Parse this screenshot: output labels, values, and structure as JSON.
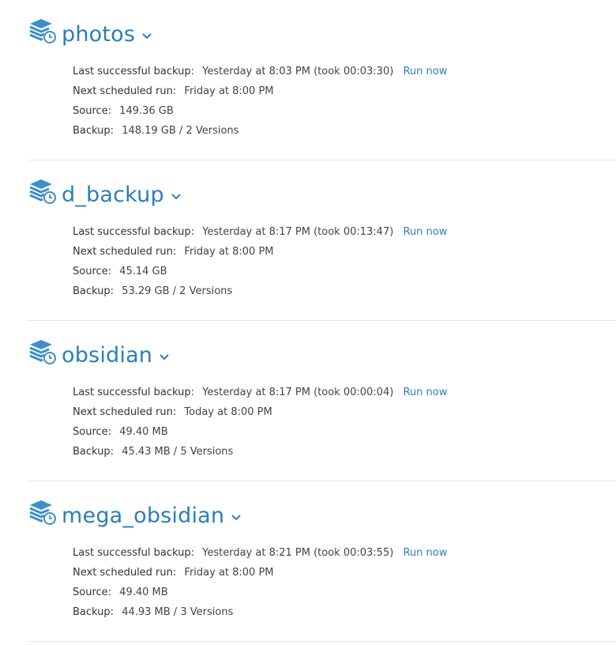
{
  "labels": {
    "last_backup": "Last successful backup:",
    "next_run": "Next scheduled run:",
    "source": "Source:",
    "backup": "Backup:",
    "run_now": "Run now"
  },
  "colors": {
    "accent": "#2a7fb7",
    "icon": "#3d8fcc",
    "divider": "#e6e6e6"
  },
  "backups": [
    {
      "name": "photos",
      "last_backup": "Yesterday at 8:03 PM (took 00:03:30)",
      "next_run": "Friday at 8:00 PM",
      "source": "149.36 GB",
      "backup": "148.19 GB / 2 Versions"
    },
    {
      "name": "d_backup",
      "last_backup": "Yesterday at 8:17 PM (took 00:13:47)",
      "next_run": "Friday at 8:00 PM",
      "source": "45.14 GB",
      "backup": "53.29 GB / 2 Versions"
    },
    {
      "name": "obsidian",
      "last_backup": "Yesterday at 8:17 PM (took 00:00:04)",
      "next_run": "Today at 8:00 PM",
      "source": "49.40 MB",
      "backup": "45.43 MB / 5 Versions"
    },
    {
      "name": "mega_obsidian",
      "last_backup": "Yesterday at 8:21 PM (took 00:03:55)",
      "next_run": "Friday at 8:00 PM",
      "source": "49.40 MB",
      "backup": "44.93 MB / 3 Versions"
    }
  ]
}
